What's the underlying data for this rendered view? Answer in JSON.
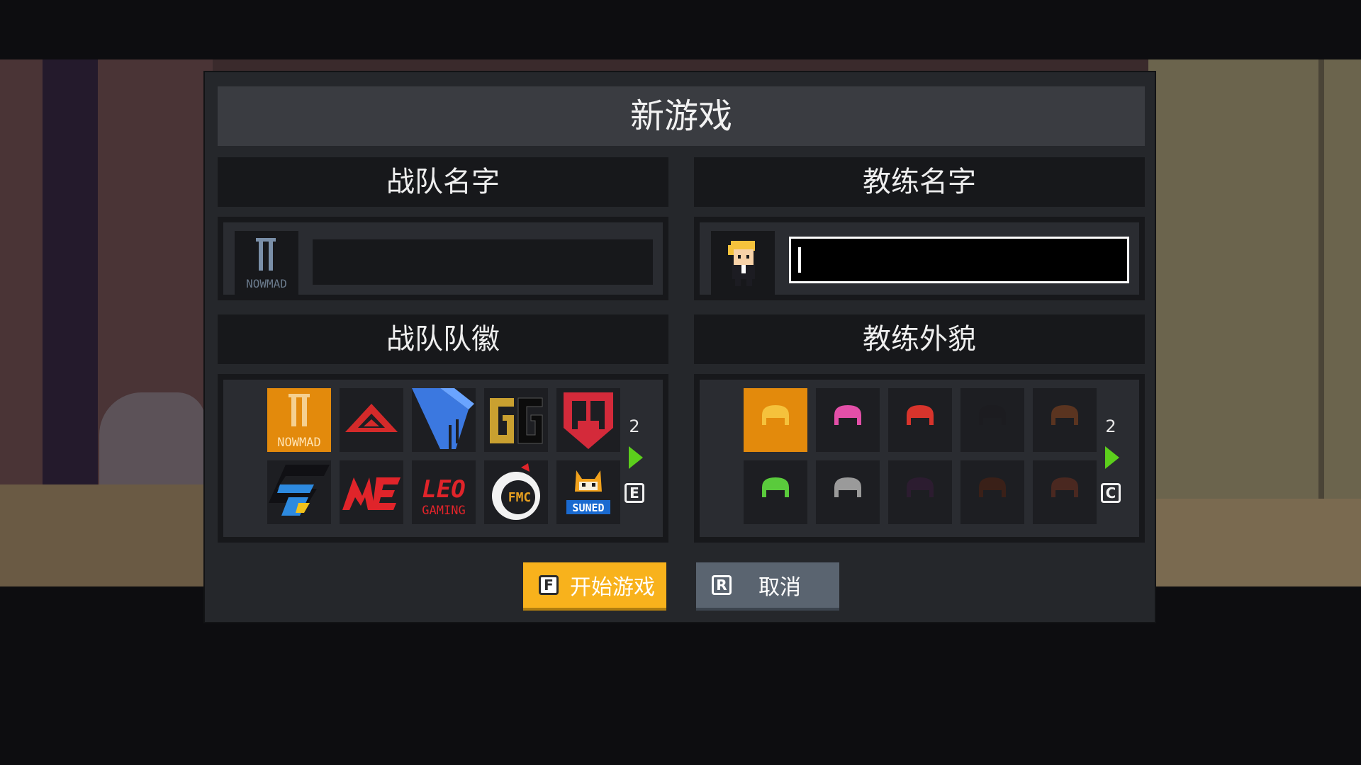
{
  "dialog": {
    "title": "新游戏",
    "team_name_header": "战队名字",
    "coach_name_header": "教练名字",
    "team_name_value": "",
    "coach_name_value": "",
    "team_logo_header": "战队队徽",
    "coach_look_header": "教练外貌"
  },
  "team_logos": {
    "page_count": "2",
    "key": "E",
    "selected_index": 0,
    "items": [
      {
        "name": "NOWMAD",
        "icon": "nowmad-logo"
      },
      {
        "name": "",
        "icon": "red-triangle-logo"
      },
      {
        "name": "",
        "icon": "blue-stripes-logo"
      },
      {
        "name": "",
        "icon": "gg-logo"
      },
      {
        "name": "",
        "icon": "red-shield-logo"
      },
      {
        "name": "",
        "icon": "blue-g-logo"
      },
      {
        "name": "",
        "icon": "red-me-logo"
      },
      {
        "name": "GAMING",
        "icon": "leo-gaming-logo",
        "mark": "LEO"
      },
      {
        "name": "FMC",
        "icon": "fmc-chicken-logo"
      },
      {
        "name": "SUNED",
        "icon": "suned-fox-logo"
      }
    ]
  },
  "coach_looks": {
    "page_count": "2",
    "key": "C",
    "selected_index": 0,
    "hair_colors": [
      "#f5c23c",
      "#e34fa8",
      "#d8342c",
      "#1c1c20",
      "#5a3420",
      "#5acb3c",
      "#9a9a9a",
      "#2c1c30",
      "#3a2018",
      "#4a2820"
    ]
  },
  "buttons": {
    "start_key": "F",
    "start_label": "开始游戏",
    "cancel_key": "R",
    "cancel_label": "取消"
  },
  "colors": {
    "selected_cell": "#e38a0c",
    "start_button": "#f8b21c",
    "cancel_button": "#5a6470",
    "page_arrow": "#5ccf1c"
  }
}
